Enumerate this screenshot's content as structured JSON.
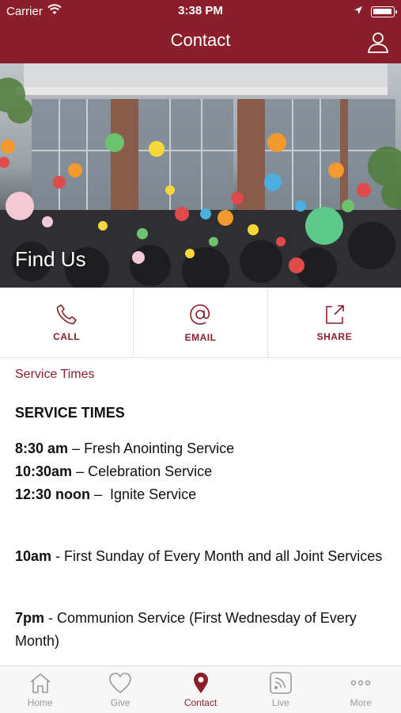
{
  "status": {
    "carrier": "Carrier",
    "time": "3:38 PM"
  },
  "nav": {
    "title": "Contact"
  },
  "hero": {
    "title": "Find Us"
  },
  "actions": [
    {
      "label": "CALL",
      "icon": "phone-icon"
    },
    {
      "label": "EMAIL",
      "icon": "at-icon"
    },
    {
      "label": "SHARE",
      "icon": "share-icon"
    }
  ],
  "content": {
    "section_label": "Service Times",
    "heading": "SERVICE TIMES",
    "services": [
      {
        "time": "8:30 am",
        "sep": " – ",
        "name": "Fresh Anointing Service"
      },
      {
        "time": "10:30am",
        "sep": " – ",
        "name": "Celebration Service"
      },
      {
        "time": "12:30 noon",
        "sep": " –  ",
        "name": "Ignite Service"
      }
    ],
    "note1": {
      "time": "10am",
      "text": " - First Sunday of Every Month and all Joint Services"
    },
    "note2": {
      "time": "7pm",
      "text": " - Communion Service (First Wednesday of Every Month)"
    }
  },
  "tabs": [
    {
      "label": "Home",
      "icon": "home-icon",
      "active": false
    },
    {
      "label": "Give",
      "icon": "heart-icon",
      "active": false
    },
    {
      "label": "Contact",
      "icon": "location-pin-icon",
      "active": true
    },
    {
      "label": "Live",
      "icon": "rss-icon",
      "active": false
    },
    {
      "label": "More",
      "icon": "more-dots-icon",
      "active": false
    }
  ],
  "colors": {
    "brand": "#8a1f2b",
    "tab_inactive": "#999999"
  }
}
